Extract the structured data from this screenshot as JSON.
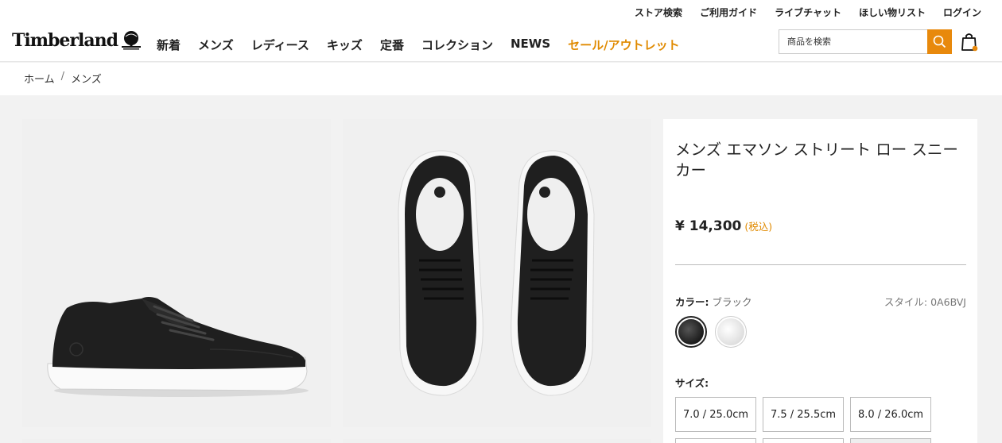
{
  "util_links": [
    "ストア検索",
    "ご利用ガイド",
    "ライブチャット",
    "ほしい物リスト",
    "ログイン"
  ],
  "logo": "Timberland",
  "nav": [
    "新着",
    "メンズ",
    "レディース",
    "キッズ",
    "定番",
    "コレクション",
    "NEWS"
  ],
  "nav_sale": "セール/アウトレット",
  "search": {
    "placeholder": "商品を検索"
  },
  "breadcrumb": {
    "home": "ホーム",
    "sep": "/",
    "current": "メンズ"
  },
  "product": {
    "title": "メンズ エマソン ストリート ロー スニーカー",
    "price": "¥ 14,300",
    "tax_note": "(税込)",
    "color_label": "カラー:",
    "color_value": "ブラック",
    "style_text": "スタイル: 0A6BVJ",
    "size_label": "サイズ:",
    "sizes": [
      "7.0 / 25.0cm",
      "7.5 / 25.5cm",
      "8.0 / 26.0cm"
    ]
  },
  "colors": {
    "accent": "#e8890c",
    "sale": "#e08a00"
  }
}
